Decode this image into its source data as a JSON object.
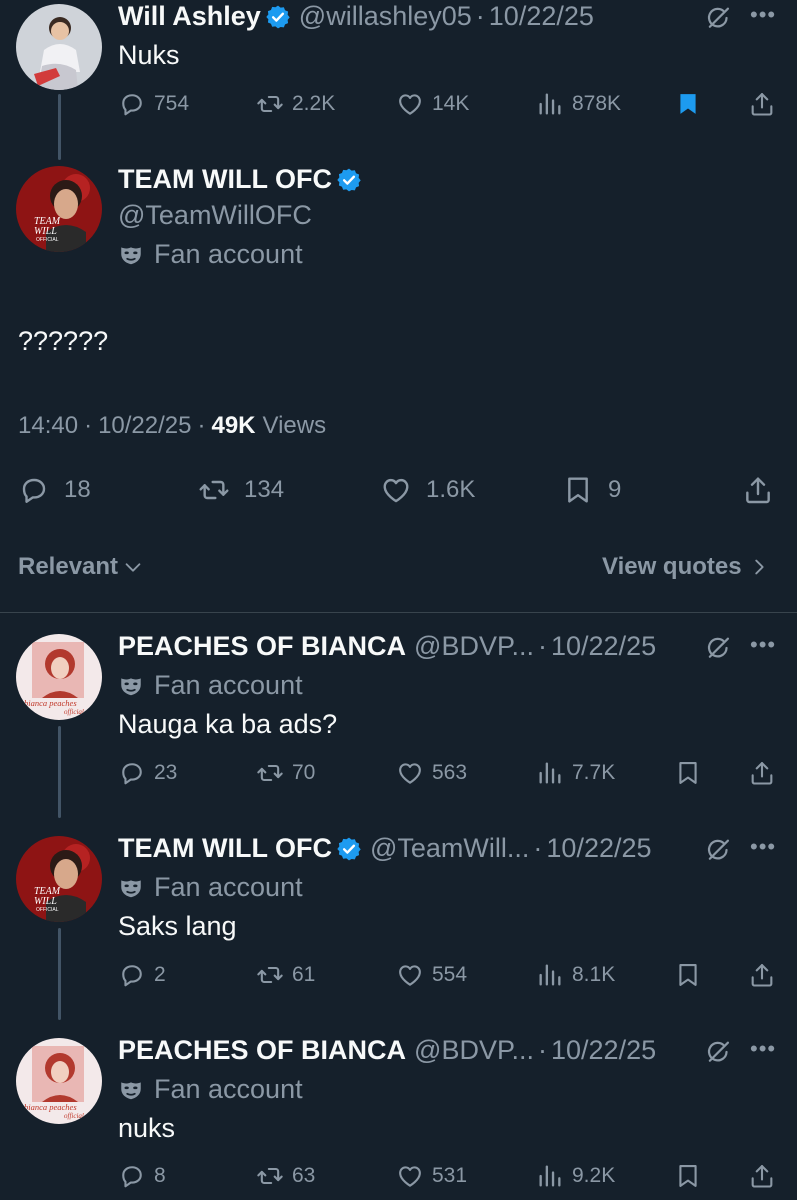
{
  "tweet1": {
    "name": "Will Ashley",
    "handle": "@willashley05",
    "sep": "·",
    "date": "10/22/25",
    "text": "Nuks",
    "replies": "754",
    "reposts": "2.2K",
    "likes": "14K",
    "views": "878K",
    "bookmarked": true
  },
  "main": {
    "name": "TEAM WILL OFC",
    "handle": "@TeamWillOFC",
    "label": "Fan account",
    "text": "??????",
    "time": "14:40",
    "sep": "·",
    "date": "10/22/25",
    "views_count": "49K",
    "views_label": "Views",
    "replies": "18",
    "reposts": "134",
    "likes": "1.6K",
    "bookmarks": "9"
  },
  "sort": {
    "relevant": "Relevant",
    "view_quotes": "View quotes"
  },
  "replies": [
    {
      "name": "PEACHES OF BIANCA",
      "handle": "@BDVP...",
      "date": "10/22/25",
      "label": "Fan account",
      "text": "Nauga ka ba ads?",
      "replies": "23",
      "reposts": "70",
      "likes": "563",
      "views": "7.7K"
    },
    {
      "name": "TEAM WILL OFC",
      "handle": "@TeamWill...",
      "date": "10/22/25",
      "label": "Fan account",
      "text": "Saks lang",
      "replies": "2",
      "reposts": "61",
      "likes": "554",
      "views": "8.1K"
    },
    {
      "name": "PEACHES OF BIANCA",
      "handle": "@BDVP...",
      "date": "10/22/25",
      "label": "Fan account",
      "text": "nuks",
      "replies": "8",
      "reposts": "63",
      "likes": "531",
      "views": "9.2K"
    }
  ],
  "reply_sep": "·",
  "avatar_texts": {
    "team_will_line1": "TEAM",
    "team_will_line2": "WILL",
    "team_will_line3": "OFFICIAL",
    "peaches_line1": "bianca peaches",
    "peaches_line2": "official"
  },
  "colors": {
    "background": "#15202b",
    "text": "#f7f9f9",
    "secondary": "#8b98a5",
    "verified": "#1d9bf0",
    "bookmark_active": "#1d9bf0",
    "divider": "#38444d"
  },
  "icons": [
    "reply-icon",
    "repost-icon",
    "like-icon",
    "views-icon",
    "bookmark-icon",
    "share-icon",
    "grok-icon",
    "more-icon",
    "verified-badge-icon",
    "fan-mask-icon",
    "chevron-down-icon",
    "chevron-right-icon"
  ]
}
